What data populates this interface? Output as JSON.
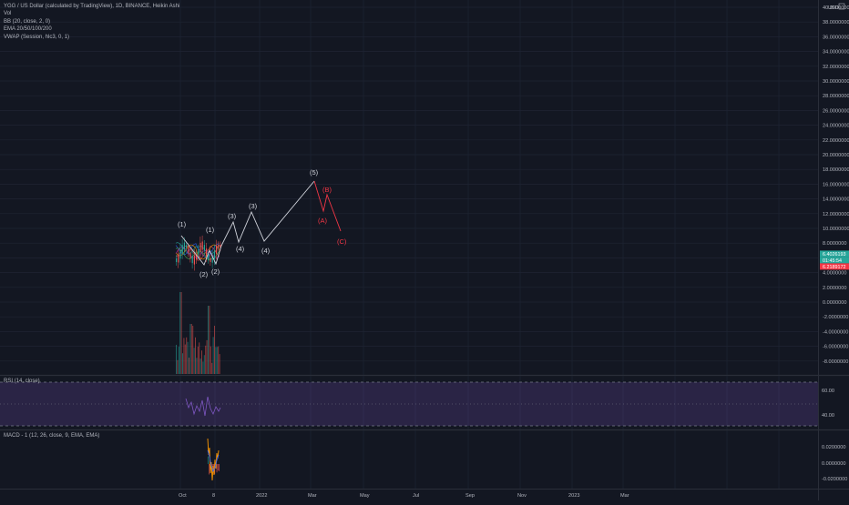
{
  "header": {
    "symbol_line": "YGG / US Dollar (calculated by TradingView), 1D, BINANCE, Heikin Ashi",
    "indicators": [
      "Vol",
      "BB (20, close, 2, 0)",
      "EMA 20/50/100/200",
      "VWAP (Session, hlc3, 0, 1)"
    ]
  },
  "price_axis": {
    "currency": "USD",
    "ticks": [
      "40.0000000",
      "38.0000000",
      "36.0000000",
      "34.0000000",
      "32.0000000",
      "30.0000000",
      "28.0000000",
      "26.0000000",
      "24.0000000",
      "22.0000000",
      "20.0000000",
      "18.0000000",
      "16.0000000",
      "14.0000000",
      "12.0000000",
      "10.0000000",
      "8.0000000",
      "6.0000000",
      "4.0000000",
      "2.0000000",
      "0.0000000",
      "-2.0000000",
      "-4.0000000",
      "-6.0000000",
      "-8.0000000"
    ],
    "price_badges": [
      {
        "text": "6.4026193",
        "color": "#26a69a"
      },
      {
        "text": "01:45:54",
        "color": "#26a69a"
      },
      {
        "text": "6.2189172",
        "color": "#f23645"
      }
    ]
  },
  "time_axis": {
    "labels": [
      "Oct",
      "8",
      "2022",
      "Mar",
      "May",
      "Jul",
      "Sep",
      "Nov",
      "2023",
      "Mar"
    ]
  },
  "elliott_labels": {
    "white": [
      "(1)",
      "(2)",
      "(1)",
      "(2)",
      "(3)",
      "(4)",
      "(3)",
      "(4)",
      "(5)"
    ],
    "red": [
      "(B)",
      "(A)",
      "(C)"
    ]
  },
  "rsi": {
    "label": "RSI (14, close)",
    "ticks": [
      "60.00",
      "40.00"
    ]
  },
  "macd": {
    "label": "MACD - 1 (12, 26, close, 9, EMA, EMA)",
    "ticks": [
      "0.0200000",
      "0.0000000",
      "-0.0200000"
    ]
  },
  "colors": {
    "background": "#131722",
    "up": "#26a69a",
    "down": "#ef5350",
    "rsi": "#7e57c2",
    "macd": "#ff9800",
    "signal": "#2962ff",
    "wave_white": "#d1d4dc",
    "wave_red": "#f23645"
  }
}
